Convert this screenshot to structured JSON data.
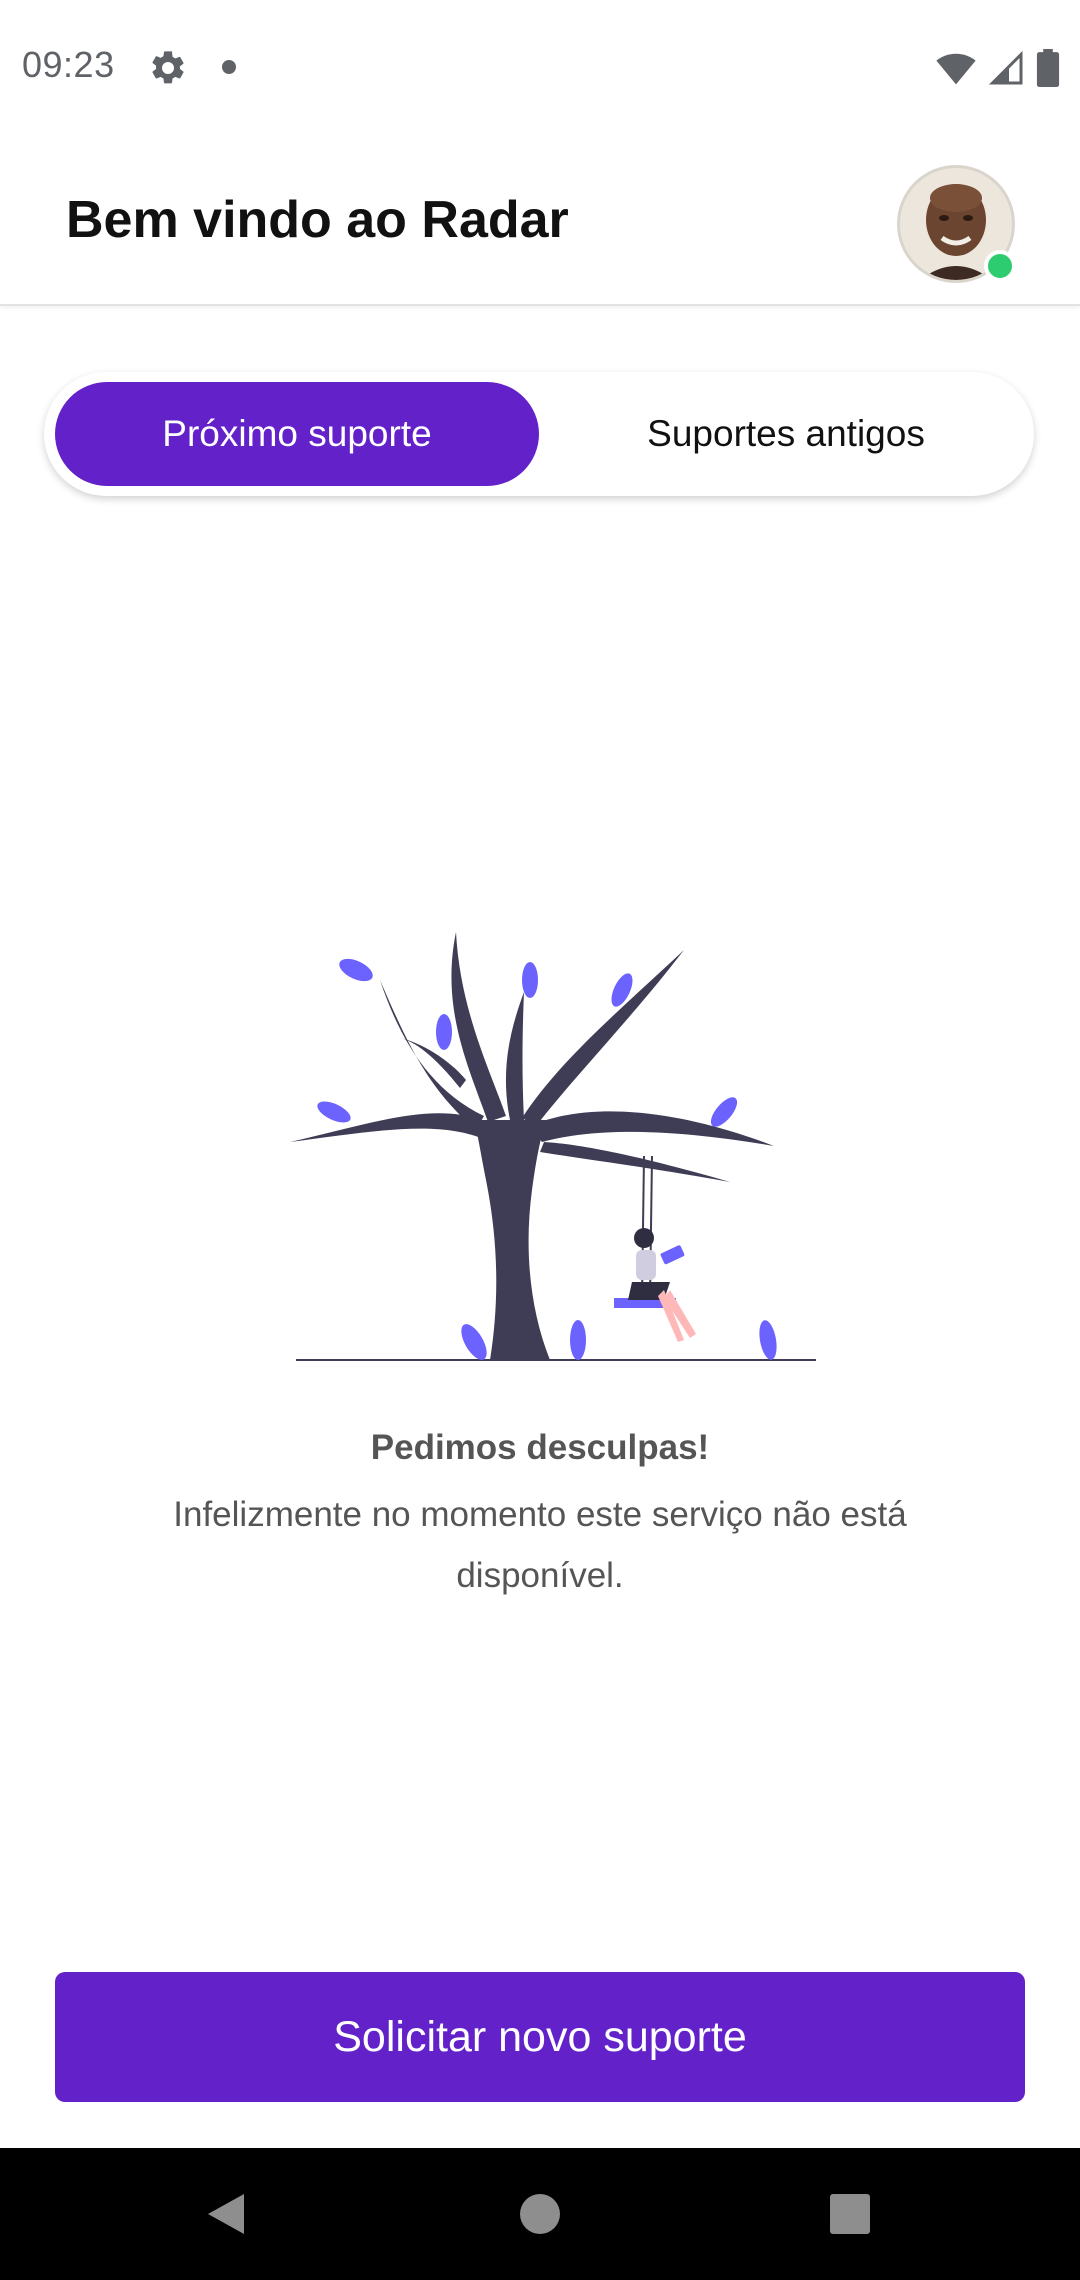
{
  "status_bar": {
    "time": "09:23",
    "icons": [
      "settings-gear-icon",
      "notification-dot-icon",
      "wifi-icon",
      "cell-signal-icon",
      "battery-icon"
    ]
  },
  "header": {
    "title": "Bem vindo ao Radar",
    "avatar_online": true
  },
  "tabs": [
    {
      "label": "Próximo suporte",
      "active": true
    },
    {
      "label": "Suportes antigos",
      "active": false
    }
  ],
  "empty_state": {
    "illustration": "tree-with-swing-illustration",
    "title": "Pedimos desculpas!",
    "message": "Infelizmente no momento este serviço não está disponível."
  },
  "cta": {
    "label": "Solicitar novo suporte"
  },
  "navigation": {
    "icons": [
      "back-triangle-icon",
      "home-circle-icon",
      "recents-square-icon"
    ]
  },
  "colors": {
    "accent": "#6322C9",
    "leaf": "#6C63FF",
    "tree": "#3F3D56",
    "online": "#2ECC71"
  }
}
